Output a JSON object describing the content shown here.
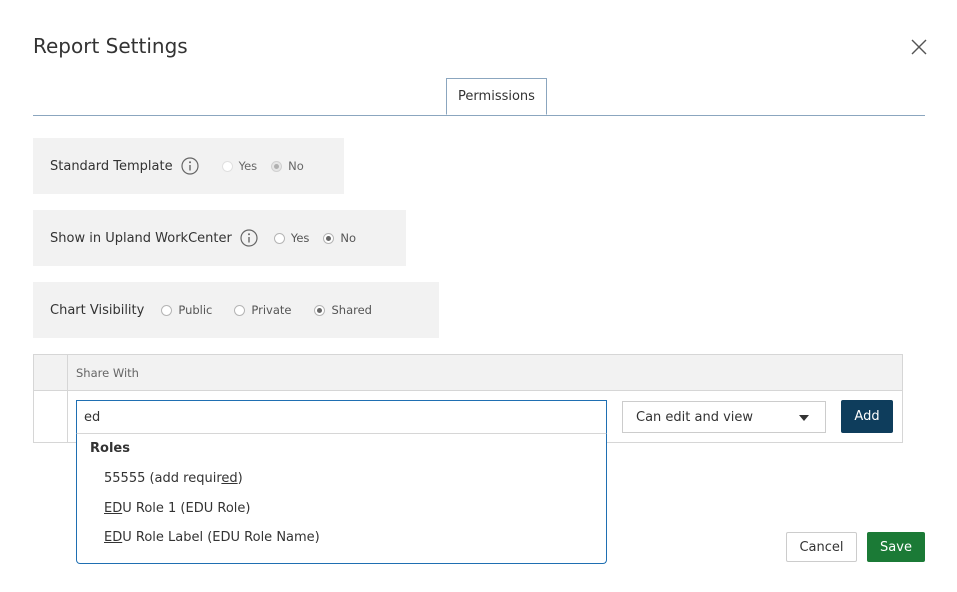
{
  "dialog": {
    "title": "Report Settings"
  },
  "tabs": [
    {
      "label": "Permissions"
    }
  ],
  "settings": {
    "standard_template": {
      "label": "Standard Template",
      "options": [
        "Yes",
        "No"
      ],
      "selected": "No",
      "disabled": true
    },
    "show_in_workcenter": {
      "label": "Show in Upland WorkCenter",
      "options": [
        "Yes",
        "No"
      ],
      "selected": "No"
    },
    "chart_visibility": {
      "label": "Chart Visibility",
      "options": [
        "Public",
        "Private",
        "Shared"
      ],
      "selected": "Shared"
    }
  },
  "share": {
    "header": "Share With",
    "search_value": "ed",
    "permission_selected": "Can edit and view",
    "add_label": "Add",
    "dropdown": {
      "group_label": "Roles",
      "items": [
        {
          "prefix": "55555 (add requir",
          "match": "ed",
          "suffix": ")"
        },
        {
          "prefix": "",
          "match": "ED",
          "suffix": "U Role 1 (EDU Role)"
        },
        {
          "prefix": "",
          "match": "ED",
          "suffix": "U Role Label (EDU Role Name)"
        }
      ]
    }
  },
  "footer": {
    "cancel_label": "Cancel",
    "save_label": "Save"
  },
  "icons": {
    "close": "close-icon",
    "info": "info-icon",
    "caret": "caret-down-icon"
  },
  "colors": {
    "primary_dark": "#0e3d5c",
    "save_green": "#1b7a36",
    "focus_blue": "#1f6fb2"
  }
}
